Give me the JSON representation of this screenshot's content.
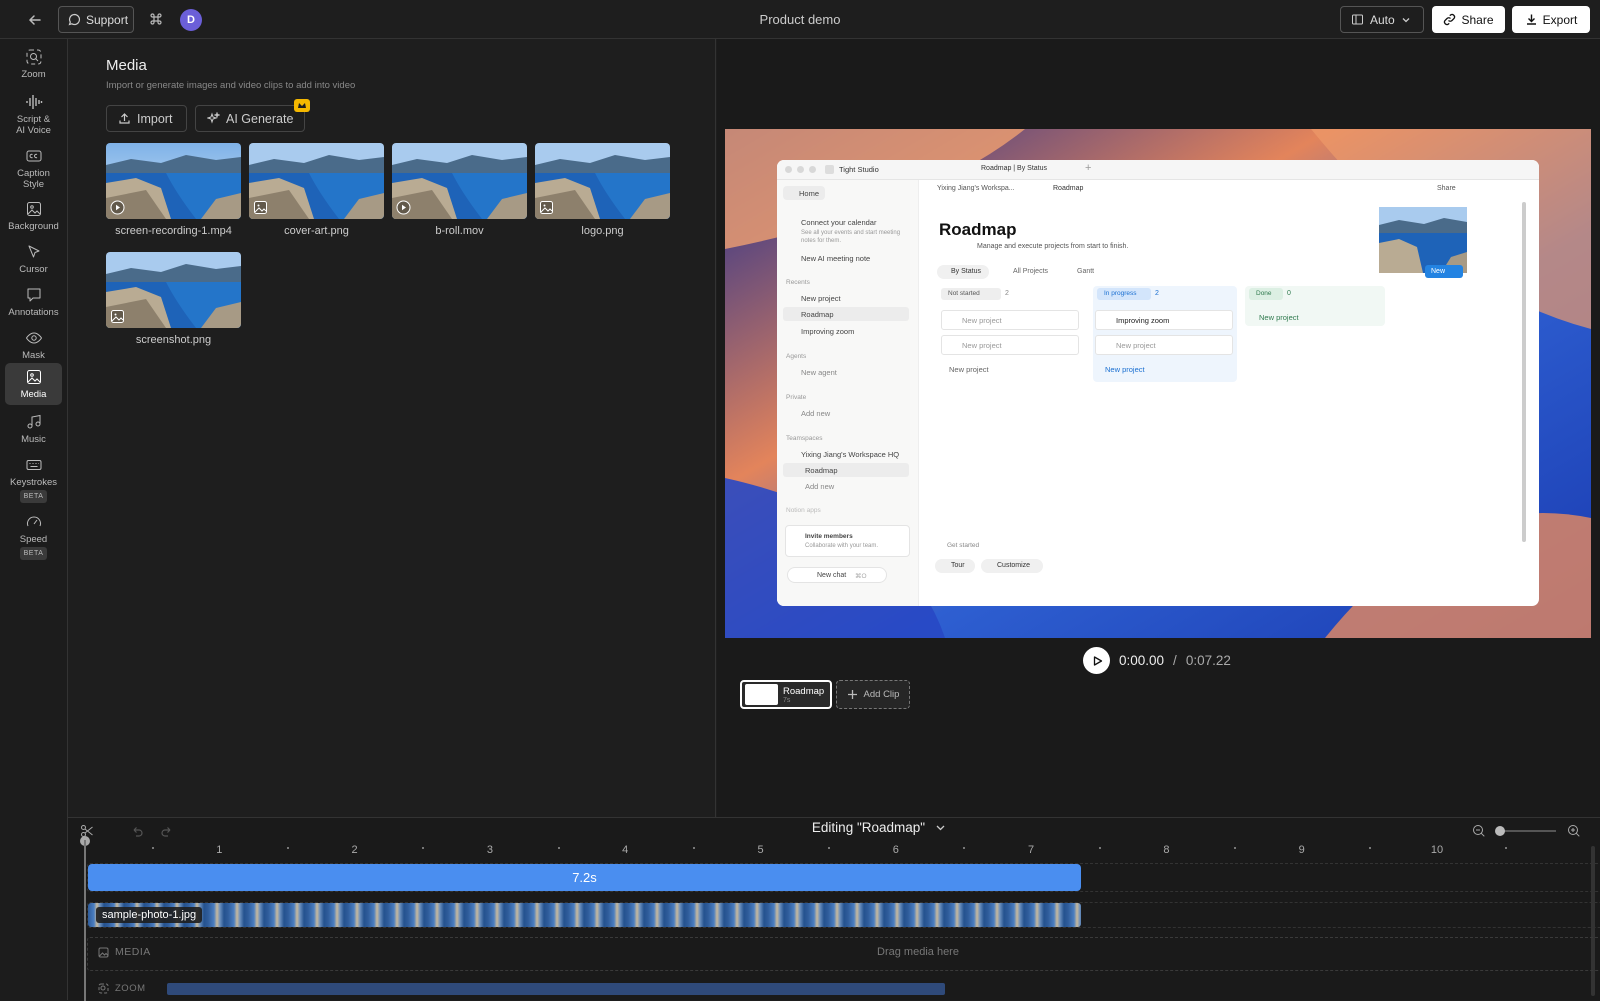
{
  "topbar": {
    "support_label": "Support",
    "avatar_initial": "D",
    "doc_title": "Product demo",
    "auto_label": "Auto",
    "share_label": "Share",
    "export_label": "Export"
  },
  "sidebar": {
    "items": [
      {
        "label": "Zoom",
        "icon": "zoom-icon"
      },
      {
        "label": "Script &\nAI Voice",
        "icon": "waveform-icon"
      },
      {
        "label": "Caption\nStyle",
        "icon": "caption-icon"
      },
      {
        "label": "Background",
        "icon": "image-icon"
      },
      {
        "label": "Cursor",
        "icon": "cursor-icon"
      },
      {
        "label": "Annotations",
        "icon": "comment-icon"
      },
      {
        "label": "Mask",
        "icon": "eye-icon"
      },
      {
        "label": "Media",
        "icon": "media-icon",
        "active": true
      },
      {
        "label": "Music",
        "icon": "music-icon"
      },
      {
        "label": "Keystrokes",
        "icon": "keyboard-icon",
        "badge": "BETA"
      },
      {
        "label": "Speed",
        "icon": "speedometer-icon",
        "badge": "BETA"
      }
    ]
  },
  "media": {
    "title": "Media",
    "subtitle": "Import or generate images and video clips to add into video",
    "import_label": "Import",
    "ai_generate_label": "AI Generate",
    "files": [
      {
        "name": "screen-recording-1.mp4",
        "kind": "video"
      },
      {
        "name": "cover-art.png",
        "kind": "image"
      },
      {
        "name": "b-roll.mov",
        "kind": "video"
      },
      {
        "name": "logo.png",
        "kind": "image"
      },
      {
        "name": "screenshot.png",
        "kind": "image"
      }
    ]
  },
  "preview": {
    "app": {
      "workspace": "Tight Studio",
      "tab_title": "Roadmap | By Status",
      "breadcrumb_1": "Yixing Jiang's Workspa...",
      "breadcrumb_2": "Roadmap",
      "share": "Share",
      "home": "Home",
      "connect_title": "Connect your calendar",
      "connect_desc": "See all your events and start meeting notes for them.",
      "new_meeting": "New AI meeting note",
      "recents": "Recents",
      "recent_items": [
        "New project",
        "Roadmap",
        "Improving zoom"
      ],
      "agents": "Agents",
      "new_agent": "New agent",
      "private": "Private",
      "add_new": "Add new",
      "teamspaces": "Teamspaces",
      "teamspace_name": "Yixing Jiang's Workspace HQ",
      "teamspace_child": "Roadmap",
      "teamspace_add": "Add new",
      "notion_apps": "Notion apps",
      "invite_title": "Invite members",
      "invite_desc": "Collaborate with your team.",
      "new_chat": "New chat",
      "new_chat_kbd": "⌘O",
      "page_title": "Roadmap",
      "page_desc": "Manage and execute projects from start to finish.",
      "view_by_status": "By Status",
      "view_all": "All Projects",
      "view_gantt": "Gantt",
      "new_btn": "New",
      "col_not_started": "Not started",
      "col_not_started_count": "2",
      "col_in_progress": "In progress",
      "col_in_progress_count": "2",
      "col_done": "Done",
      "col_done_count": "0",
      "card_new_project": "New project",
      "card_improving": "Improving zoom",
      "add_new_project": "New project",
      "get_started": "Get started",
      "tour": "Tour",
      "customize": "Customize"
    },
    "time_current": "0:00.00",
    "time_sep": "/",
    "time_total": "0:07.22",
    "clip_label": "Roadmap",
    "clip_duration": "7s",
    "add_clip_label": "Add Clip"
  },
  "timeline": {
    "editing_label": "Editing \"Roadmap\"",
    "ticks": [
      "1",
      "2",
      "3",
      "4",
      "5",
      "6",
      "7",
      "8",
      "9",
      "10"
    ],
    "zoom_segment_label": "7.2s",
    "media_clip_label": "sample-photo-1.jpg",
    "media_lane_label": "MEDIA",
    "drag_hint": "Drag media here",
    "zoom_lane_label": "ZOOM"
  }
}
